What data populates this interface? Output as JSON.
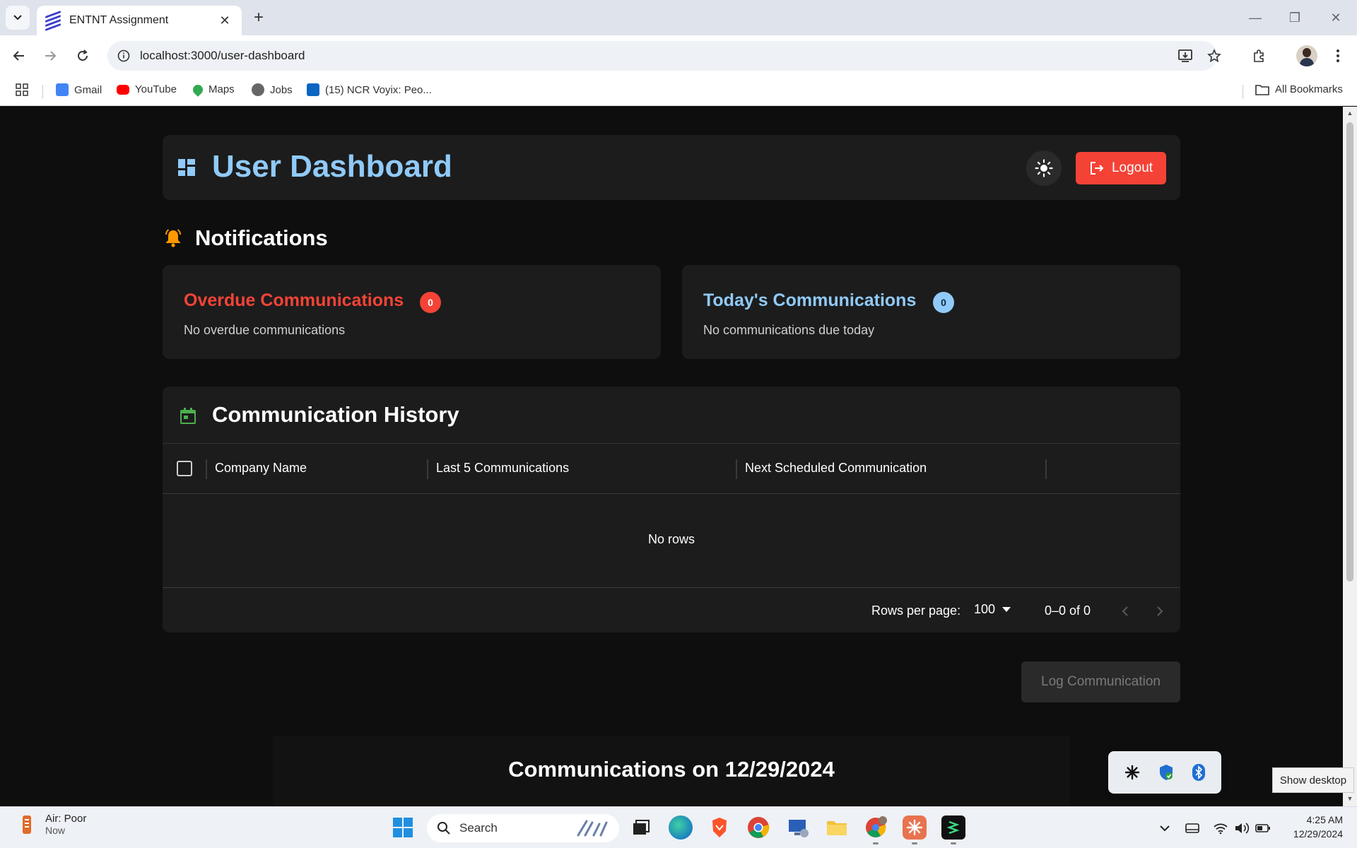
{
  "browser": {
    "tab_title": "ENTNT Assignment",
    "url": "localhost:3000/user-dashboard",
    "bookmarks": [
      "Gmail",
      "YouTube",
      "Maps",
      "Jobs",
      "(15) NCR Voyix: Peo..."
    ],
    "all_bookmarks": "All Bookmarks"
  },
  "header": {
    "title": "User Dashboard",
    "logout_label": "Logout"
  },
  "notifications": {
    "heading": "Notifications",
    "overdue": {
      "title": "Overdue Communications",
      "count": "0",
      "empty_text": "No overdue communications",
      "color": "#f44336"
    },
    "today": {
      "title": "Today's Communications",
      "count": "0",
      "empty_text": "No communications due today",
      "color": "#90caf9"
    }
  },
  "history": {
    "title": "Communication History",
    "columns": [
      "Company Name",
      "Last 5 Communications",
      "Next Scheduled Communication"
    ],
    "empty_text": "No rows",
    "rows_per_page_label": "Rows per page:",
    "rows_per_page_value": "100",
    "range_text": "0–0 of 0"
  },
  "log_button": "Log Communication",
  "comms_day": {
    "title": "Communications on 12/29/2024"
  },
  "tooltip": "Show desktop",
  "taskbar": {
    "weather_main": "Air: Poor",
    "weather_sub": "Now",
    "search_placeholder": "Search",
    "time": "4:25 AM",
    "date": "12/29/2024"
  },
  "colors": {
    "accent": "#90caf9",
    "danger": "#f44336",
    "background": "#0e0e0e",
    "card": "#1c1c1c"
  }
}
